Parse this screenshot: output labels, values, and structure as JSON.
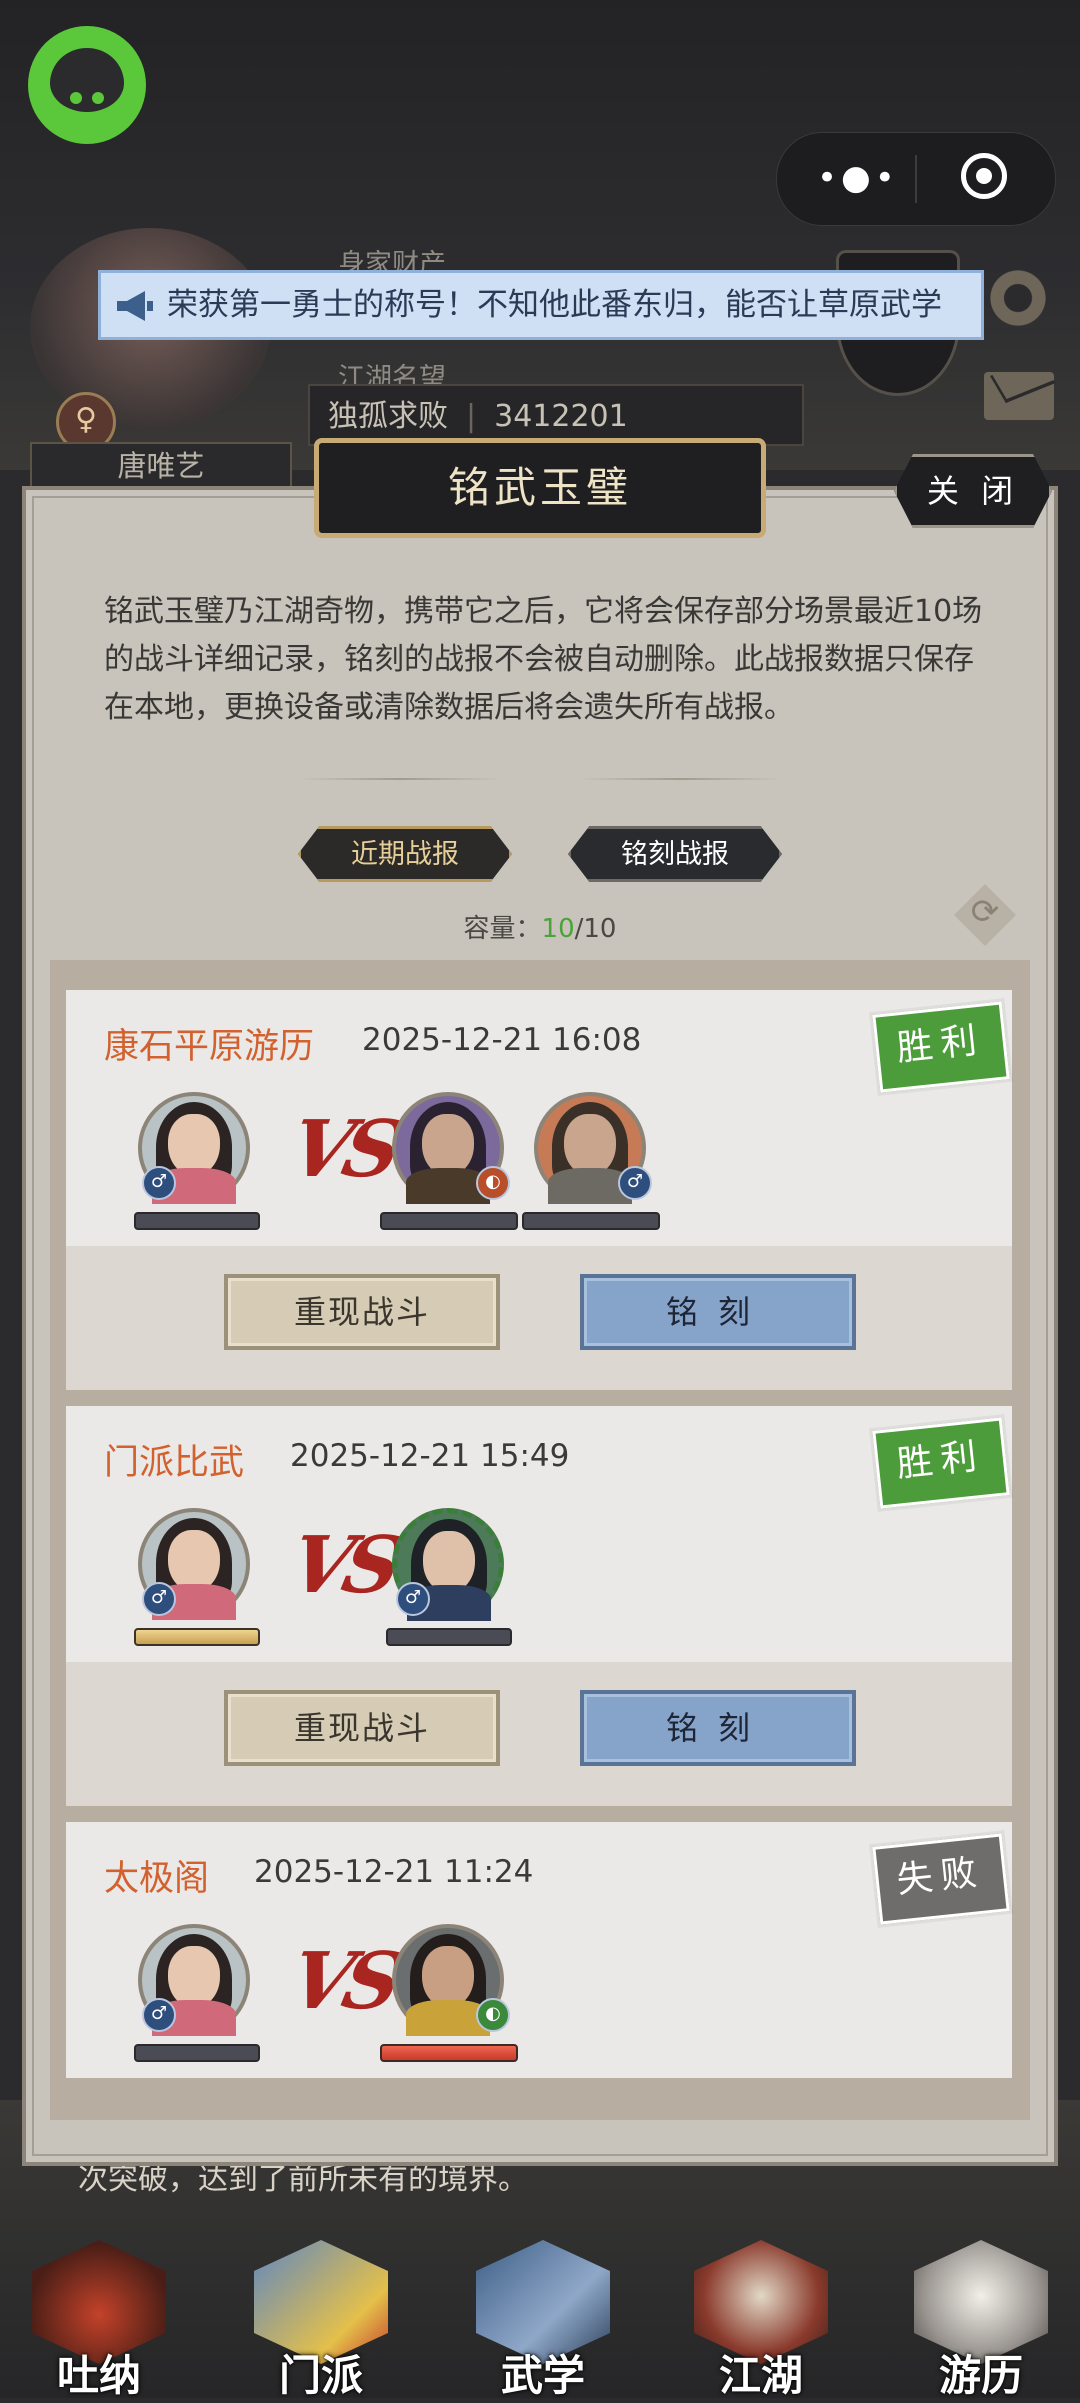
{
  "hud": {
    "assets_label": "身家财产",
    "reputation_label": "江湖名望",
    "title": "独孤求败",
    "reputation_value": "3412201",
    "player_name": "唐唯艺",
    "marquee": "荣获第一勇士的称号！不知他此番东归，能否让草原武学"
  },
  "modal": {
    "title": "铭武玉璧",
    "close_label": "关 闭",
    "description": "铭武玉璧乃江湖奇物，携带它之后，它将会保存部分场景最近10场的战斗详细记录，铭刻的战报不会被自动删除。此战报数据只保存在本地，更换设备或清除数据后将会遗失所有战报。",
    "tabs": {
      "recent": "近期战报",
      "engraved": "铭刻战报"
    },
    "capacity_label": "容量：",
    "capacity_current": "10",
    "capacity_total": "/10",
    "records": [
      {
        "name": "康石平原游历",
        "time": "2025-12-21 16:08",
        "result": "胜利",
        "vs": "VS",
        "replay_label": "重现战斗",
        "engrave_label": "铭刻"
      },
      {
        "name": "门派比武",
        "time": "2025-12-21 15:49",
        "result": "胜利",
        "vs": "VS",
        "replay_label": "重现战斗",
        "engrave_label": "铭刻"
      },
      {
        "name": "太极阁",
        "time": "2025-12-21 11:24",
        "result": "失败",
        "vs": "VS"
      }
    ]
  },
  "bottom": {
    "hint": "次突破，达到了前所未有的境界。",
    "nav": [
      {
        "label": "吐纳"
      },
      {
        "label": "门派"
      },
      {
        "label": "武学"
      },
      {
        "label": "江湖"
      },
      {
        "label": "游历"
      }
    ]
  },
  "colors": {
    "win": "#4d9c3b",
    "lose": "#6f6d6b",
    "record_name": "#d2612e",
    "capacity_ok": "#4aa33a"
  }
}
